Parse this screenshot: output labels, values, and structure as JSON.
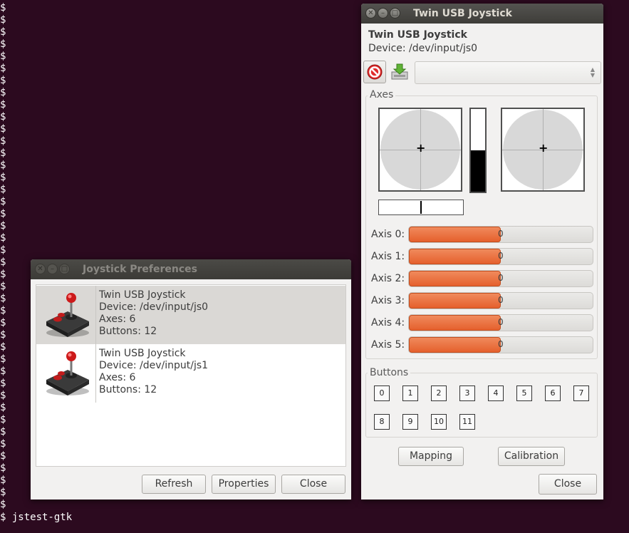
{
  "terminal": {
    "prompt_symbol": "$",
    "command_line": "$ jstest-gtk"
  },
  "prefs_window": {
    "title": "Joystick Preferences",
    "devices": [
      {
        "name": "Twin USB Joystick",
        "device": "Device: /dev/input/js0",
        "axes": "Axes: 6",
        "buttons": "Buttons: 12",
        "selected": true
      },
      {
        "name": "Twin USB Joystick",
        "device": "Device: /dev/input/js1",
        "axes": "Axes: 6",
        "buttons": "Buttons: 12",
        "selected": false
      }
    ],
    "refresh_label": "Refresh",
    "properties_label": "Properties",
    "close_label": "Close"
  },
  "joy_window": {
    "title": "Twin USB Joystick",
    "heading": "Twin USB Joystick",
    "device": "Device: /dev/input/js0",
    "axes_label": "Axes",
    "throttle_level": 0.5,
    "axes": [
      {
        "label": "Axis 0:",
        "value": "0",
        "fill": 0.5
      },
      {
        "label": "Axis 1:",
        "value": "0",
        "fill": 0.5
      },
      {
        "label": "Axis 2:",
        "value": "0",
        "fill": 0.5
      },
      {
        "label": "Axis 3:",
        "value": "0",
        "fill": 0.5
      },
      {
        "label": "Axis 4:",
        "value": "0",
        "fill": 0.5
      },
      {
        "label": "Axis 5:",
        "value": "0",
        "fill": 0.5
      }
    ],
    "buttons_label": "Buttons",
    "buttons": [
      "0",
      "1",
      "2",
      "3",
      "4",
      "5",
      "6",
      "7",
      "8",
      "9",
      "10",
      "11"
    ],
    "mapping_label": "Mapping",
    "calibration_label": "Calibration",
    "close_label": "Close"
  },
  "colors": {
    "terminal_bg": "#2c0a1f",
    "axis_fill": "#e5602d",
    "window_bg": "#f2f1f0"
  }
}
